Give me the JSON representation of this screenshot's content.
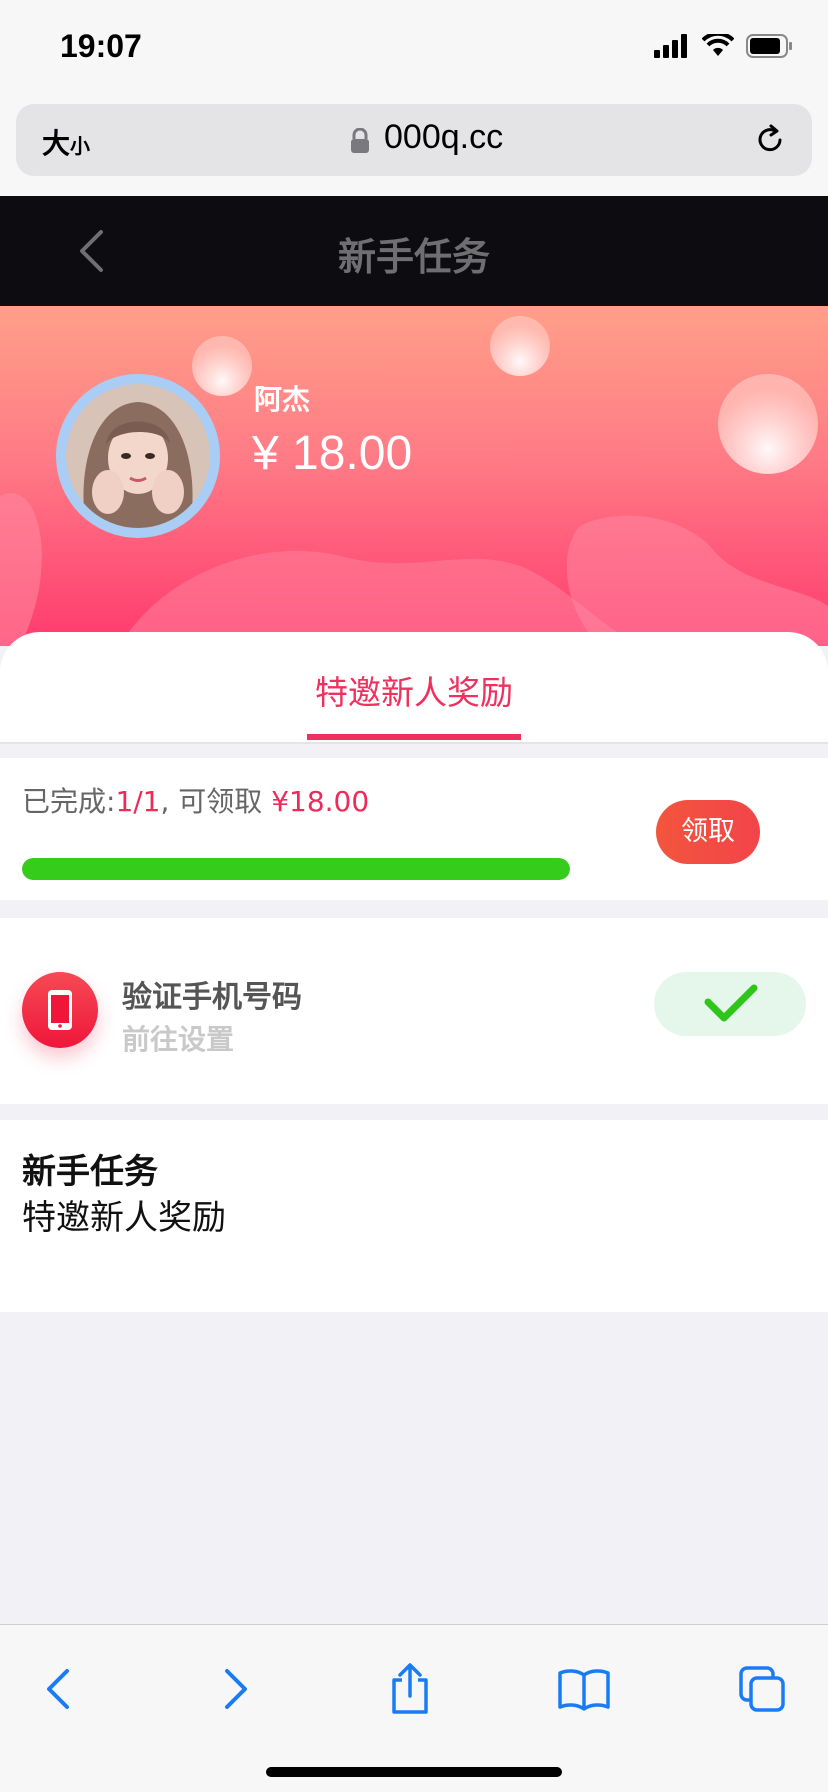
{
  "status_bar": {
    "time": "19:07"
  },
  "browser": {
    "size_label_big": "大",
    "size_label_small": "小",
    "url": "000q.cc"
  },
  "nav": {
    "title": "新手任务"
  },
  "user": {
    "name": "阿杰",
    "balance": "¥ 18.00"
  },
  "tabs": [
    {
      "label": "特邀新人奖励",
      "active": true
    }
  ],
  "progress": {
    "prefix": "已完成:",
    "count": "1/1",
    "middle": ", 可领取 ",
    "amount": "¥18.00",
    "fraction": 1.0,
    "claim_label": "领取"
  },
  "task": {
    "title": "验证手机号码",
    "subtitle": "前往设置",
    "status": "completed"
  },
  "description": {
    "title": "新手任务",
    "body": "特邀新人奖励"
  },
  "colors": {
    "accent": "#f0305f",
    "progress": "#36cc1c",
    "nav_bg": "#0d0d11",
    "ios_blue": "#1a7cf5"
  },
  "toolbar": {
    "icons": [
      "back-icon",
      "forward-icon",
      "share-icon",
      "bookmarks-icon",
      "tabs-icon"
    ]
  }
}
